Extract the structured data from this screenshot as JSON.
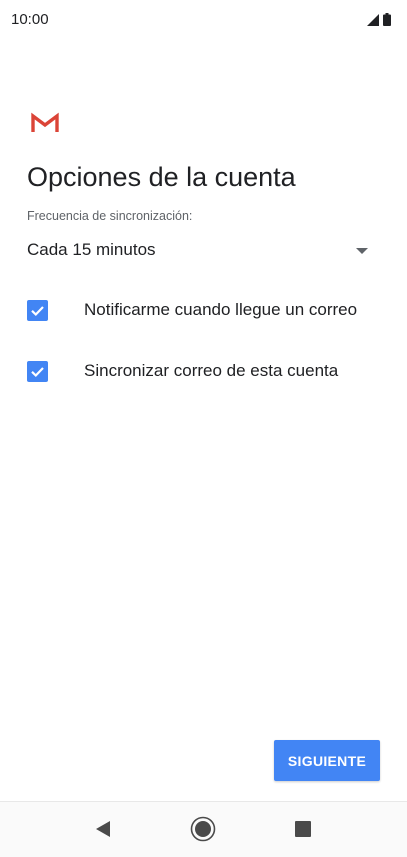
{
  "status_bar": {
    "time": "10:00",
    "icons": [
      "signal-icon",
      "battery-icon"
    ]
  },
  "app": {
    "logo": "gmail-logo",
    "title": "Opciones de la cuenta"
  },
  "sync": {
    "label": "Frecuencia de sincronización:",
    "selected": "Cada 15 minutos"
  },
  "options": [
    {
      "label": "Notificarme cuando llegue un correo",
      "checked": true
    },
    {
      "label": "Sincronizar correo de esta cuenta",
      "checked": true
    }
  ],
  "actions": {
    "next_label": "SIGUIENTE"
  },
  "nav": {
    "buttons": [
      "back-icon",
      "home-icon",
      "recents-icon"
    ]
  },
  "colors": {
    "accent": "#4285f4",
    "gmail_red": "#db4437",
    "text": "#202124",
    "secondary_text": "#5f6368"
  }
}
